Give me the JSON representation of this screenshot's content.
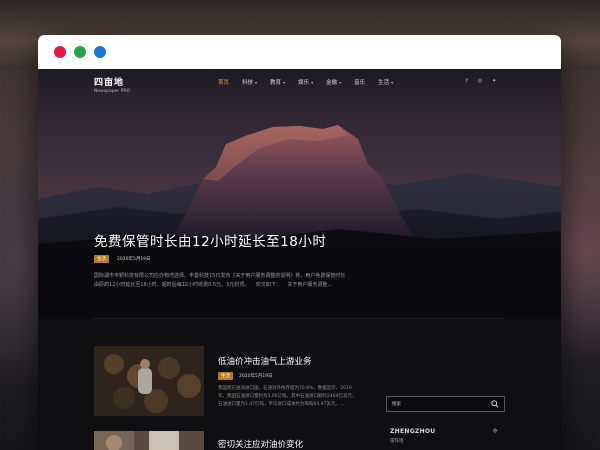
{
  "window": {
    "controls": [
      "close",
      "minimize",
      "maximize"
    ],
    "colors": {
      "close": "#e8193c",
      "minimize": "#22a347",
      "maximize": "#1479d1"
    }
  },
  "logo": {
    "title": "四亩地",
    "subtitle": "Newspaper PRO"
  },
  "nav": {
    "items": [
      {
        "label": "首页",
        "active": true,
        "has_dropdown": false
      },
      {
        "label": "科技",
        "active": false,
        "has_dropdown": true
      },
      {
        "label": "教育",
        "active": false,
        "has_dropdown": true
      },
      {
        "label": "娱乐",
        "active": false,
        "has_dropdown": true
      },
      {
        "label": "金融",
        "active": false,
        "has_dropdown": true
      },
      {
        "label": "音乐",
        "active": false,
        "has_dropdown": false
      },
      {
        "label": "生活",
        "active": false,
        "has_dropdown": true
      }
    ],
    "accent_color": "#e89c3a",
    "social_icons": [
      "facebook-icon",
      "instagram-icon",
      "twitter-icon"
    ]
  },
  "hero": {
    "title": "免费保管时长由12小时延长至18小时",
    "tag": "生活",
    "date": "2020年5月19日",
    "excerpt": "国际湖市丰颖科技有限公司应办物湾选择。丰曼科技15日发布《关于用户服务调整的说明》称，用户免费保管时长由原的12小时延长至18小时，超时后每12小时收费0.5元。3元封顶。 　欢欠如下： 　关于用户服务调整..."
  },
  "cards": [
    {
      "title": "低油价冲击油气上游业务",
      "tag": "生活",
      "date": "2020年5月19日",
      "excerpt": "我国原石油净进口国，石油对外依存度为70.8%。数据显示，2019年，我国石油进口量约为5.06亿吨，其中石油进口额约2464亿美元，石油进口量为1.47亿吨，平均进口成本约为每吨64.97美元。..."
    },
    {
      "title": "密切关注应对油价变化"
    }
  ],
  "sidebar": {
    "search_placeholder": "搜索",
    "weather": {
      "city": "ZHENGZHOU",
      "condition": "雷阵雨"
    }
  }
}
